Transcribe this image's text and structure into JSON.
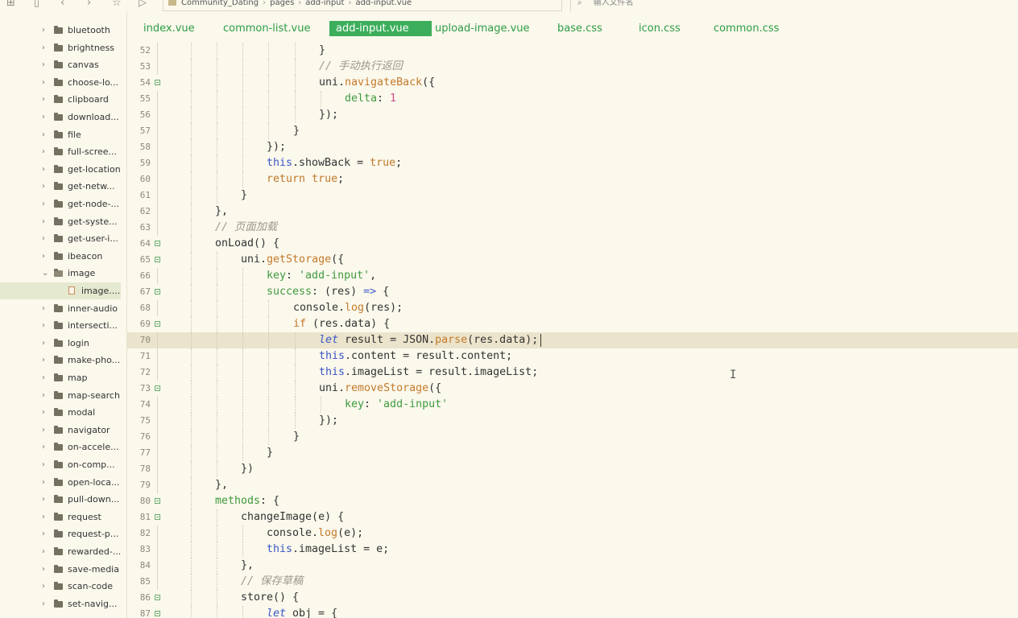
{
  "toolbar": {
    "breadcrumbs": [
      "Community_Dating",
      "pages",
      "add-input",
      "add-input.vue"
    ],
    "search_placeholder": "输入文件名"
  },
  "sidebar": {
    "items": [
      {
        "label": "bluetooth",
        "type": "folder"
      },
      {
        "label": "brightness",
        "type": "folder"
      },
      {
        "label": "canvas",
        "type": "folder"
      },
      {
        "label": "choose-lo...",
        "type": "folder"
      },
      {
        "label": "clipboard",
        "type": "folder"
      },
      {
        "label": "download...",
        "type": "folder"
      },
      {
        "label": "file",
        "type": "folder"
      },
      {
        "label": "full-scree...",
        "type": "folder"
      },
      {
        "label": "get-location",
        "type": "folder"
      },
      {
        "label": "get-netw...",
        "type": "folder"
      },
      {
        "label": "get-node-...",
        "type": "folder"
      },
      {
        "label": "get-syste...",
        "type": "folder"
      },
      {
        "label": "get-user-i...",
        "type": "folder"
      },
      {
        "label": "ibeacon",
        "type": "folder"
      },
      {
        "label": "image",
        "type": "folder-open"
      },
      {
        "label": "image....",
        "type": "file",
        "selected": true
      },
      {
        "label": "inner-audio",
        "type": "folder"
      },
      {
        "label": "intersecti...",
        "type": "folder"
      },
      {
        "label": "login",
        "type": "folder"
      },
      {
        "label": "make-pho...",
        "type": "folder"
      },
      {
        "label": "map",
        "type": "folder"
      },
      {
        "label": "map-search",
        "type": "folder"
      },
      {
        "label": "modal",
        "type": "folder"
      },
      {
        "label": "navigator",
        "type": "folder"
      },
      {
        "label": "on-accele...",
        "type": "folder"
      },
      {
        "label": "on-comp...",
        "type": "folder"
      },
      {
        "label": "open-loca...",
        "type": "folder"
      },
      {
        "label": "pull-down...",
        "type": "folder"
      },
      {
        "label": "request",
        "type": "folder"
      },
      {
        "label": "request-p...",
        "type": "folder"
      },
      {
        "label": "rewarded-...",
        "type": "folder"
      },
      {
        "label": "save-media",
        "type": "folder"
      },
      {
        "label": "scan-code",
        "type": "folder"
      },
      {
        "label": "set-navig...",
        "type": "folder"
      }
    ]
  },
  "tabs": [
    {
      "label": "index.vue",
      "active": false
    },
    {
      "label": "common-list.vue",
      "active": false
    },
    {
      "label": "add-input.vue",
      "active": true
    },
    {
      "label": "upload-image.vue",
      "active": false
    },
    {
      "label": "base.css",
      "active": false
    },
    {
      "label": "icon.css",
      "active": false
    },
    {
      "label": "common.css",
      "active": false
    }
  ],
  "editor": {
    "current_line": 70,
    "lines": [
      {
        "n": 52,
        "indent": 6,
        "tokens": [
          [
            "pl",
            "}"
          ]
        ]
      },
      {
        "n": 53,
        "indent": 6,
        "tokens": [
          [
            "cm",
            "// 手动执行返回"
          ]
        ]
      },
      {
        "n": 54,
        "indent": 6,
        "fold": true,
        "tokens": [
          [
            "pl",
            "uni."
          ],
          [
            "fn",
            "navigateBack"
          ],
          [
            "pl",
            "({"
          ]
        ]
      },
      {
        "n": 55,
        "indent": 7,
        "tokens": [
          [
            "prop",
            "delta"
          ],
          [
            "pl",
            ": "
          ],
          [
            "num",
            "1"
          ]
        ]
      },
      {
        "n": 56,
        "indent": 6,
        "tokens": [
          [
            "pl",
            "});"
          ]
        ]
      },
      {
        "n": 57,
        "indent": 5,
        "tokens": [
          [
            "pl",
            "}"
          ]
        ]
      },
      {
        "n": 58,
        "indent": 4,
        "tokens": [
          [
            "pl",
            "});"
          ]
        ]
      },
      {
        "n": 59,
        "indent": 4,
        "tokens": [
          [
            "th",
            "this"
          ],
          [
            "pl",
            ".showBack = "
          ],
          [
            "kw",
            "true"
          ],
          [
            "pl",
            ";"
          ]
        ]
      },
      {
        "n": 60,
        "indent": 4,
        "tokens": [
          [
            "kw",
            "return"
          ],
          [
            "pl",
            " "
          ],
          [
            "kw",
            "true"
          ],
          [
            "pl",
            ";"
          ]
        ]
      },
      {
        "n": 61,
        "indent": 3,
        "tokens": [
          [
            "pl",
            "}"
          ]
        ]
      },
      {
        "n": 62,
        "indent": 2,
        "tokens": [
          [
            "pl",
            "},"
          ]
        ]
      },
      {
        "n": 63,
        "indent": 2,
        "tokens": [
          [
            "cm",
            "// 页面加载"
          ]
        ]
      },
      {
        "n": 64,
        "indent": 2,
        "fold": true,
        "tokens": [
          [
            "pl",
            "onLoad() {"
          ]
        ]
      },
      {
        "n": 65,
        "indent": 3,
        "fold": true,
        "tokens": [
          [
            "pl",
            "uni."
          ],
          [
            "fn",
            "getStorage"
          ],
          [
            "pl",
            "({"
          ]
        ]
      },
      {
        "n": 66,
        "indent": 4,
        "tokens": [
          [
            "prop",
            "key"
          ],
          [
            "pl",
            ": "
          ],
          [
            "str",
            "'add-input'"
          ],
          [
            "pl",
            ","
          ]
        ]
      },
      {
        "n": 67,
        "indent": 4,
        "fold": true,
        "tokens": [
          [
            "prop",
            "success"
          ],
          [
            "pl",
            ": (res) "
          ],
          [
            "th",
            "=>"
          ],
          [
            "pl",
            " {"
          ]
        ]
      },
      {
        "n": 68,
        "indent": 5,
        "tokens": [
          [
            "pl",
            "console."
          ],
          [
            "fn",
            "log"
          ],
          [
            "pl",
            "(res);"
          ]
        ]
      },
      {
        "n": 69,
        "indent": 5,
        "fold": true,
        "tokens": [
          [
            "kw",
            "if"
          ],
          [
            "pl",
            " (res.data) {"
          ]
        ]
      },
      {
        "n": 70,
        "indent": 6,
        "tokens": [
          [
            "kwi",
            "let"
          ],
          [
            "pl",
            " result = JSON."
          ],
          [
            "fn",
            "parse"
          ],
          [
            "pl",
            "(res.data);"
          ]
        ]
      },
      {
        "n": 71,
        "indent": 6,
        "tokens": [
          [
            "th",
            "this"
          ],
          [
            "pl",
            ".content = result.content;"
          ]
        ]
      },
      {
        "n": 72,
        "indent": 6,
        "tokens": [
          [
            "th",
            "this"
          ],
          [
            "pl",
            ".imageList = result.imageList;"
          ]
        ]
      },
      {
        "n": 73,
        "indent": 6,
        "fold": true,
        "tokens": [
          [
            "pl",
            "uni."
          ],
          [
            "fn",
            "removeStorage"
          ],
          [
            "pl",
            "({"
          ]
        ]
      },
      {
        "n": 74,
        "indent": 7,
        "tokens": [
          [
            "prop",
            "key"
          ],
          [
            "pl",
            ": "
          ],
          [
            "str",
            "'add-input'"
          ]
        ]
      },
      {
        "n": 75,
        "indent": 6,
        "tokens": [
          [
            "pl",
            "});"
          ]
        ]
      },
      {
        "n": 76,
        "indent": 5,
        "tokens": [
          [
            "pl",
            "}"
          ]
        ]
      },
      {
        "n": 77,
        "indent": 4,
        "tokens": [
          [
            "pl",
            "}"
          ]
        ]
      },
      {
        "n": 78,
        "indent": 3,
        "tokens": [
          [
            "pl",
            "})"
          ]
        ]
      },
      {
        "n": 79,
        "indent": 2,
        "tokens": [
          [
            "pl",
            "},"
          ]
        ]
      },
      {
        "n": 80,
        "indent": 2,
        "fold": true,
        "tokens": [
          [
            "prop",
            "methods"
          ],
          [
            "pl",
            ": {"
          ]
        ]
      },
      {
        "n": 81,
        "indent": 3,
        "fold": true,
        "tokens": [
          [
            "pl",
            "changeImage(e) {"
          ]
        ]
      },
      {
        "n": 82,
        "indent": 4,
        "tokens": [
          [
            "pl",
            "console."
          ],
          [
            "fn",
            "log"
          ],
          [
            "pl",
            "(e);"
          ]
        ]
      },
      {
        "n": 83,
        "indent": 4,
        "tokens": [
          [
            "th",
            "this"
          ],
          [
            "pl",
            ".imageList = e;"
          ]
        ]
      },
      {
        "n": 84,
        "indent": 3,
        "tokens": [
          [
            "pl",
            "},"
          ]
        ]
      },
      {
        "n": 85,
        "indent": 3,
        "tokens": [
          [
            "cm",
            "// 保存草稿"
          ]
        ]
      },
      {
        "n": 86,
        "indent": 3,
        "fold": true,
        "tokens": [
          [
            "pl",
            "store() {"
          ]
        ]
      },
      {
        "n": 87,
        "indent": 4,
        "fold": true,
        "tokens": [
          [
            "kwi",
            "let"
          ],
          [
            "pl",
            " obj = {"
          ]
        ]
      }
    ]
  }
}
